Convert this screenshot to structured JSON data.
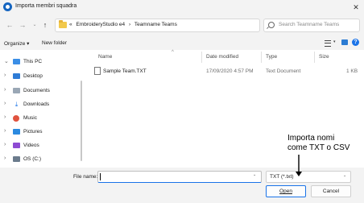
{
  "window": {
    "title": "Importa membri squadra",
    "close_glyph": "✕"
  },
  "nav": {
    "back": "←",
    "forward": "→",
    "history": "⌄",
    "up": "↑",
    "breadcrumbs": [
      "«",
      "EmbroideryStudio e4",
      "›",
      "Teamname Teams"
    ],
    "address_dropdown": "⌄",
    "refresh": "↻",
    "search_placeholder": "Search Teamname Teams"
  },
  "commandbar": {
    "organize": "Organize ▾",
    "new_folder": "New folder"
  },
  "sidebar": {
    "items": [
      {
        "chevron": "⌄",
        "label": "This PC",
        "icon": "pc-icon"
      },
      {
        "chevron": "›",
        "label": "Desktop",
        "icon": "desktop-icon"
      },
      {
        "chevron": "›",
        "label": "Documents",
        "icon": "documents-icon"
      },
      {
        "chevron": "›",
        "label": "Downloads",
        "icon": "downloads-icon"
      },
      {
        "chevron": "›",
        "label": "Music",
        "icon": "music-icon"
      },
      {
        "chevron": "›",
        "label": "Pictures",
        "icon": "pictures-icon"
      },
      {
        "chevron": "›",
        "label": "Videos",
        "icon": "videos-icon"
      },
      {
        "chevron": "›",
        "label": "OS (C:)",
        "icon": "drive-icon"
      }
    ],
    "download_glyph": "⤓"
  },
  "columns": {
    "name": "Name",
    "modified": "Date modified",
    "type": "Type",
    "size": "Size",
    "sort_caret": "^"
  },
  "files": [
    {
      "name": "Sample Team.TXT",
      "modified": "17/09/2020 4:57 PM",
      "type": "Text Document",
      "size": "1 KB"
    }
  ],
  "footer": {
    "filename_label": "File name:",
    "filename_value": "",
    "filename_dropdown": "⌄",
    "filetype_value": "TXT (*.txt)",
    "filetype_dropdown": "⌄",
    "open_label": "Open",
    "cancel_label": "Cancel"
  },
  "annotation": {
    "line1": "Importa nomi",
    "line2": "come TXT o CSV"
  },
  "colors": {
    "accent": "#1a73e8",
    "folder": "#f2c94c"
  }
}
